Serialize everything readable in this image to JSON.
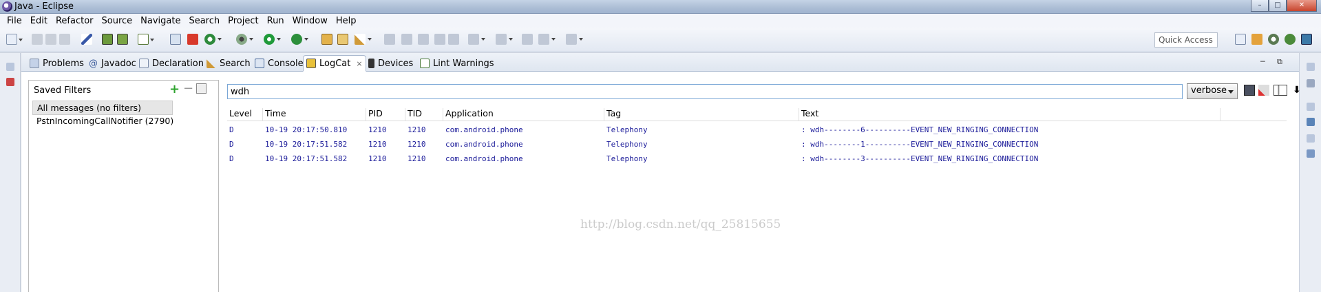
{
  "window": {
    "title": "Java - Eclipse",
    "min": "–",
    "max": "□",
    "close": "✕"
  },
  "menu": [
    "File",
    "Edit",
    "Refactor",
    "Source",
    "Navigate",
    "Search",
    "Project",
    "Run",
    "Window",
    "Help"
  ],
  "toolbar": {
    "quick_access": "Quick Access"
  },
  "tabs": [
    "Problems",
    "Javadoc",
    "Declaration",
    "Search",
    "Console",
    "LogCat",
    "Devices",
    "Lint Warnings"
  ],
  "tab_close": "⨯",
  "view_controls": {
    "minimize": "─",
    "maximize": "⧉"
  },
  "logcat": {
    "saved_filters_title": "Saved Filters",
    "add_filter": "+",
    "remove_filter": "−",
    "filters": [
      "All messages (no filters)",
      "PstnIncomingCallNotifier (2790)"
    ],
    "search_value": "wdh",
    "log_level": "verbose",
    "columns": [
      "Level",
      "Time",
      "PID",
      "TID",
      "Application",
      "Tag",
      "Text"
    ],
    "rows": [
      [
        "D",
        "10-19 20:17:50.810",
        "1210",
        "1210",
        "com.android.phone",
        "Telephony",
        ": wdh--------6----------EVENT_NEW_RINGING_CONNECTION"
      ],
      [
        "D",
        "10-19 20:17:51.582",
        "1210",
        "1210",
        "com.android.phone",
        "Telephony",
        ": wdh--------1----------EVENT_NEW_RINGING_CONNECTION"
      ],
      [
        "D",
        "10-19 20:17:51.582",
        "1210",
        "1210",
        "com.android.phone",
        "Telephony",
        ": wdh--------3----------EVENT_NEW_RINGING_CONNECTION"
      ]
    ],
    "watermark": "http://blog.csdn.net/qq_25815655"
  },
  "colors": {
    "log_text": "#1a1a99",
    "add_green": "#2ea32e",
    "titlebar": "#aebfd6"
  }
}
